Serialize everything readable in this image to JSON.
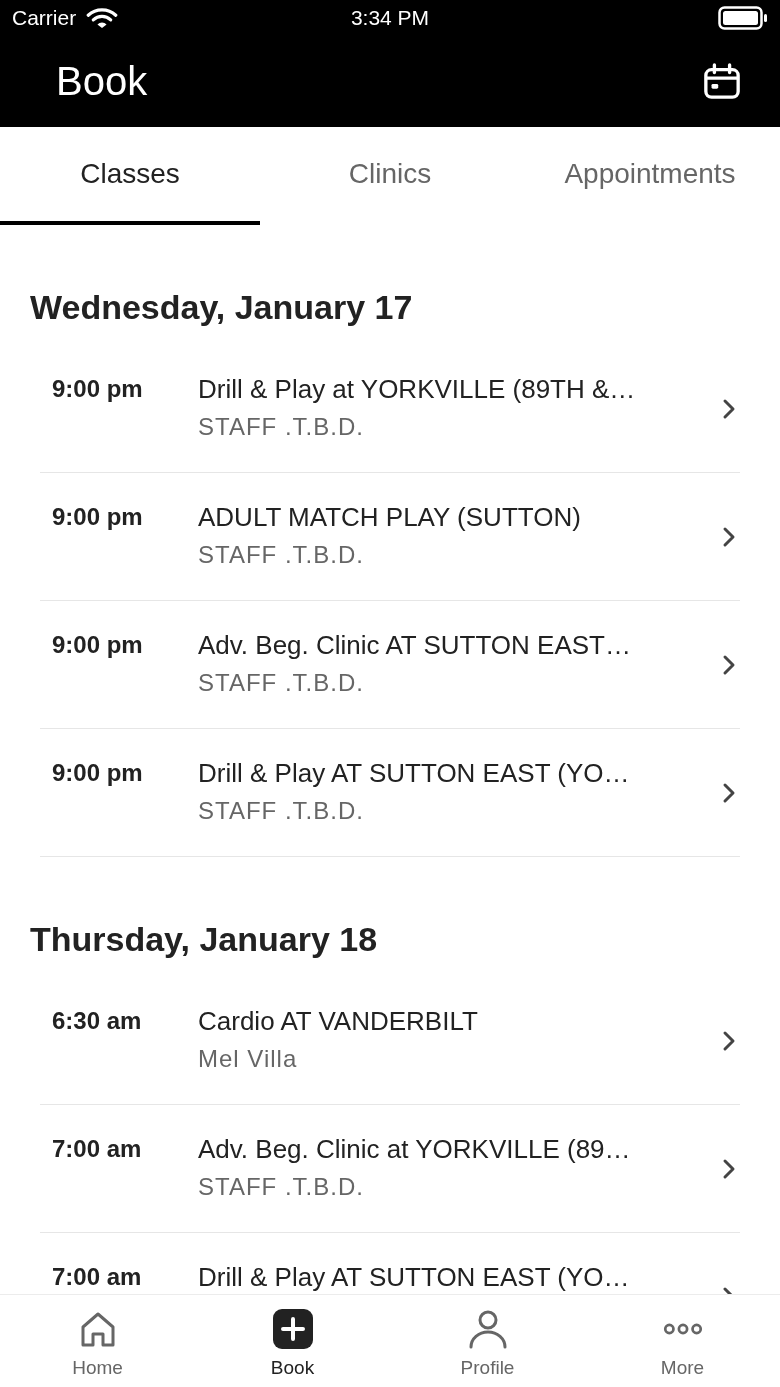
{
  "status_bar": {
    "carrier": "Carrier",
    "time": "3:34 PM"
  },
  "header": {
    "title": "Book"
  },
  "tabs": [
    {
      "label": "Classes",
      "selected": true
    },
    {
      "label": "Clinics",
      "selected": false
    },
    {
      "label": "Appointments",
      "selected": false
    }
  ],
  "sections": [
    {
      "heading": "Wednesday, January 17",
      "rows": [
        {
          "time": "9:00 pm",
          "title": "Drill & Play at YORKVILLE (89TH &…",
          "staff": "STAFF .T.B.D."
        },
        {
          "time": "9:00 pm",
          "title": "ADULT MATCH PLAY (SUTTON)",
          "staff": "STAFF .T.B.D."
        },
        {
          "time": "9:00 pm",
          "title": "Adv. Beg. Clinic AT SUTTON EAST…",
          "staff": "STAFF .T.B.D."
        },
        {
          "time": "9:00 pm",
          "title": "Drill & Play AT SUTTON EAST (YO…",
          "staff": "STAFF .T.B.D."
        }
      ]
    },
    {
      "heading": "Thursday, January 18",
      "rows": [
        {
          "time": "6:30 am",
          "title": "Cardio AT VANDERBILT",
          "staff": "Mel Villa"
        },
        {
          "time": "7:00 am",
          "title": "Adv. Beg. Clinic at YORKVILLE (89…",
          "staff": "STAFF .T.B.D."
        },
        {
          "time": "7:00 am",
          "title": "Drill & Play AT SUTTON EAST (YO…"
        }
      ]
    }
  ],
  "bottom_nav": [
    {
      "kind": "home",
      "label": "Home",
      "selected": false
    },
    {
      "kind": "book",
      "label": "Book",
      "selected": true
    },
    {
      "kind": "profile",
      "label": "Profile",
      "selected": false
    },
    {
      "kind": "more",
      "label": "More",
      "selected": false
    }
  ]
}
